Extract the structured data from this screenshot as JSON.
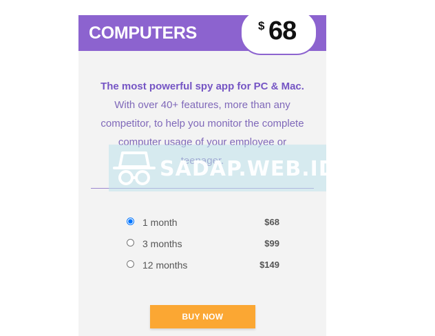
{
  "card": {
    "title": "COMPUTERS",
    "price": {
      "currency": "$",
      "amount": "68"
    },
    "description": {
      "strong": "The most powerful spy app for PC & Mac.",
      "rest": " With over 40+ features, more than any competitor, to help you monitor the complete computer usage of your employee or teenager."
    },
    "plans": [
      {
        "label": "1 month",
        "price": "$68",
        "selected": true
      },
      {
        "label": "3 months",
        "price": "$99",
        "selected": false
      },
      {
        "label": "12 months",
        "price": "$149",
        "selected": false
      }
    ],
    "buy_label": "BUY NOW"
  },
  "watermark": {
    "text": "SADAP.WEB.ID",
    "icon": "spy-hat-glasses-icon"
  },
  "colors": {
    "header": "#8c63cf",
    "button": "#fba733",
    "text_accent": "#7f68b9"
  }
}
